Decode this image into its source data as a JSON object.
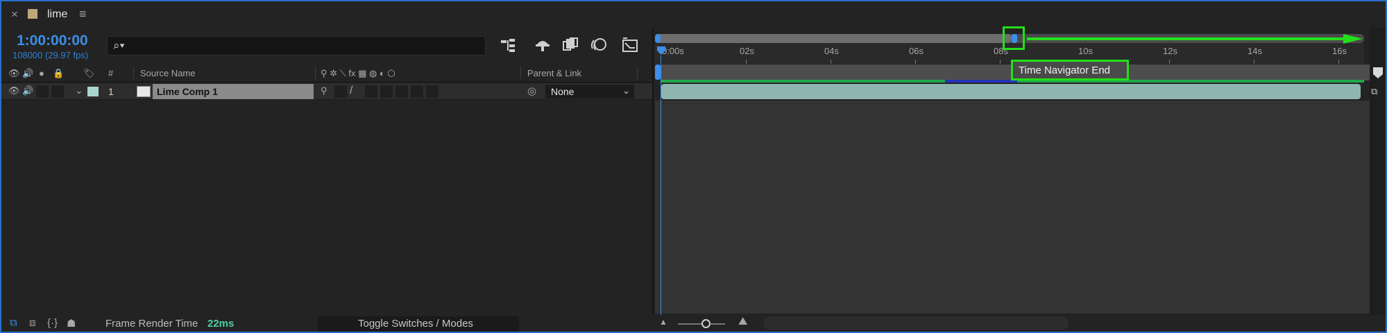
{
  "tab": {
    "close": "×",
    "title": "lime",
    "menu": "≡",
    "swatch_color": "#bfa67a"
  },
  "header": {
    "timecode": "1:00:00:00",
    "fps_text": "108000 (29.97 fps)",
    "search_placeholder": "",
    "search_icon": "⌕▾"
  },
  "columns": {
    "num": "#",
    "source_name": "Source Name",
    "parent_link": "Parent & Link"
  },
  "layer": {
    "number": "1",
    "name": "Lime Comp 1",
    "label_color": "#a9d6cf",
    "parent": "None"
  },
  "ruler": {
    "labels": [
      "0:00s",
      "02s",
      "04s",
      "06s",
      "08s",
      "10s",
      "12s",
      "14s",
      "16s"
    ]
  },
  "annotation": {
    "label": "Time Navigator End",
    "color": "#22e01a"
  },
  "bottom": {
    "render_label": "Frame Render Time",
    "render_value": "22ms",
    "toggle_label": "Toggle Switches / Modes"
  },
  "colors": {
    "accent_blue": "#3d8ee8",
    "render_green": "#4fd0a7",
    "layer_bar": "#8fb5b0",
    "cache_green": "#1fa94a",
    "cache_blue": "#2335b8"
  }
}
